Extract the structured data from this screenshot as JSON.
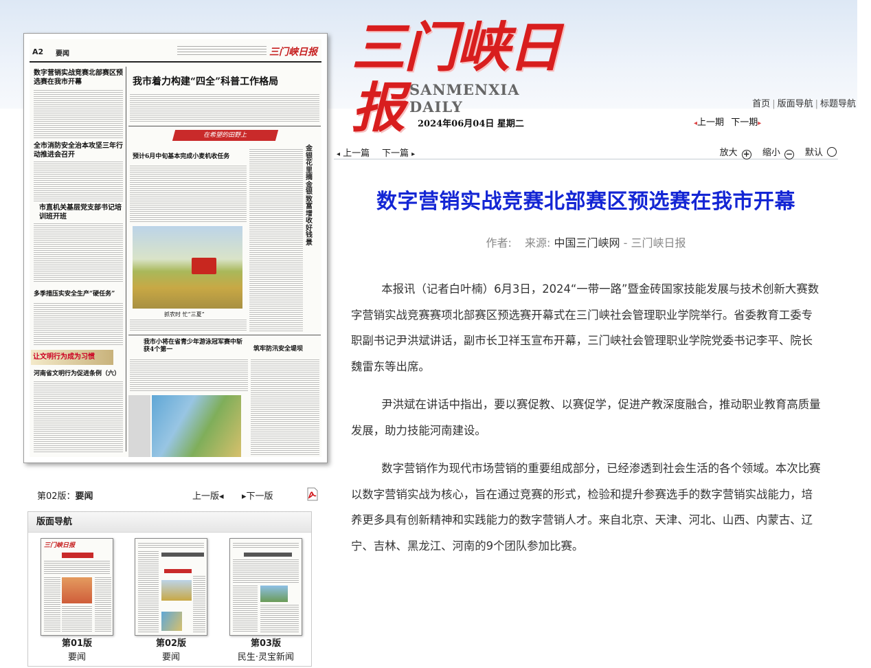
{
  "masthead": {
    "logo_cn": "三门峡日报",
    "logo_en": "SANMENXIA DAILY"
  },
  "top_nav": {
    "home": "首页",
    "layout_nav": "版面导航",
    "title_nav": "标题导航"
  },
  "date": "2024年06月04日 星期二",
  "issue_nav": {
    "prev": "上一期",
    "next": "下一期"
  },
  "page_image": {
    "page_no": "A2",
    "section": "要闻",
    "logo": "三门峡日报",
    "headlines": {
      "h1": "数字营销实战竞赛北部赛区预选赛在我市开幕",
      "h2": "我市着力构建“四全”科普工作格局",
      "h3": "全市消防安全治本攻坚三年行动推进会召开",
      "h4": "市直机关基层党支部书记培训班开班",
      "h5": "多季措压实安全生产“硬任务”",
      "h6": "预计6月中旬基本完成小麦机收任务",
      "h7": "我市小将在省青少年游泳冠军赛中斩获4个第一",
      "h8": "筑牢防汛安全堤坝",
      "h9": "河南省文明行为促进条例（六）",
      "banner": "在希望的田野上",
      "vertical": "金银花里摘金银致富增收好钱景",
      "civil": "让文明行为成为习惯",
      "photo_caption": "抓农时 忙“三夏”"
    }
  },
  "page_nav": {
    "label": "第02版：",
    "label_value": "要闻",
    "prev": "上一版",
    "next": "下一版"
  },
  "layout_nav": {
    "title": "版面导航",
    "pages": [
      {
        "num": "第01版",
        "name": "要闻",
        "logo": "三门峡日报"
      },
      {
        "num": "第02版",
        "name": "要闻",
        "logo": ""
      },
      {
        "num": "第03版",
        "name": "民生·灵宝新闻",
        "logo": ""
      }
    ]
  },
  "article_toolbar": {
    "prev": "上一篇",
    "next": "下一篇",
    "zoom_in": "放大",
    "zoom_out": "缩小",
    "default": "默认"
  },
  "article": {
    "title": "数字营销实战竞赛北部赛区预选赛在我市开幕",
    "author_label": "作者:",
    "source_label": "来源:",
    "source": "中国三门峡网",
    "paper": "- 三门峡日报",
    "paragraphs": [
      "本报讯（记者白叶楠）6月3日，2024“一带一路”暨金砖国家技能发展与技术创新大赛数字营销实战竞赛赛项北部赛区预选赛开幕式在三门峡社会管理职业学院举行。省委教育工委专职副书记尹洪斌讲话，副市长卫祥玉宣布开幕，三门峡社会管理职业学院党委书记李平、院长魏雷东等出席。",
      "尹洪斌在讲话中指出，要以赛促教、以赛促学，促进产教深度融合，推动职业教育高质量发展，助力技能河南建设。",
      "数字营销作为现代市场营销的重要组成部分，已经渗透到社会生活的各个领域。本次比赛以数字营销实战为核心，旨在通过竞赛的形式，检验和提升参赛选手的数字营销实战能力，培养更多具有创新精神和实践能力的数字营销人才。来自北京、天津、河北、山西、内蒙古、辽宁、吉林、黑龙江、河南的9个团队参加比赛。"
    ]
  }
}
